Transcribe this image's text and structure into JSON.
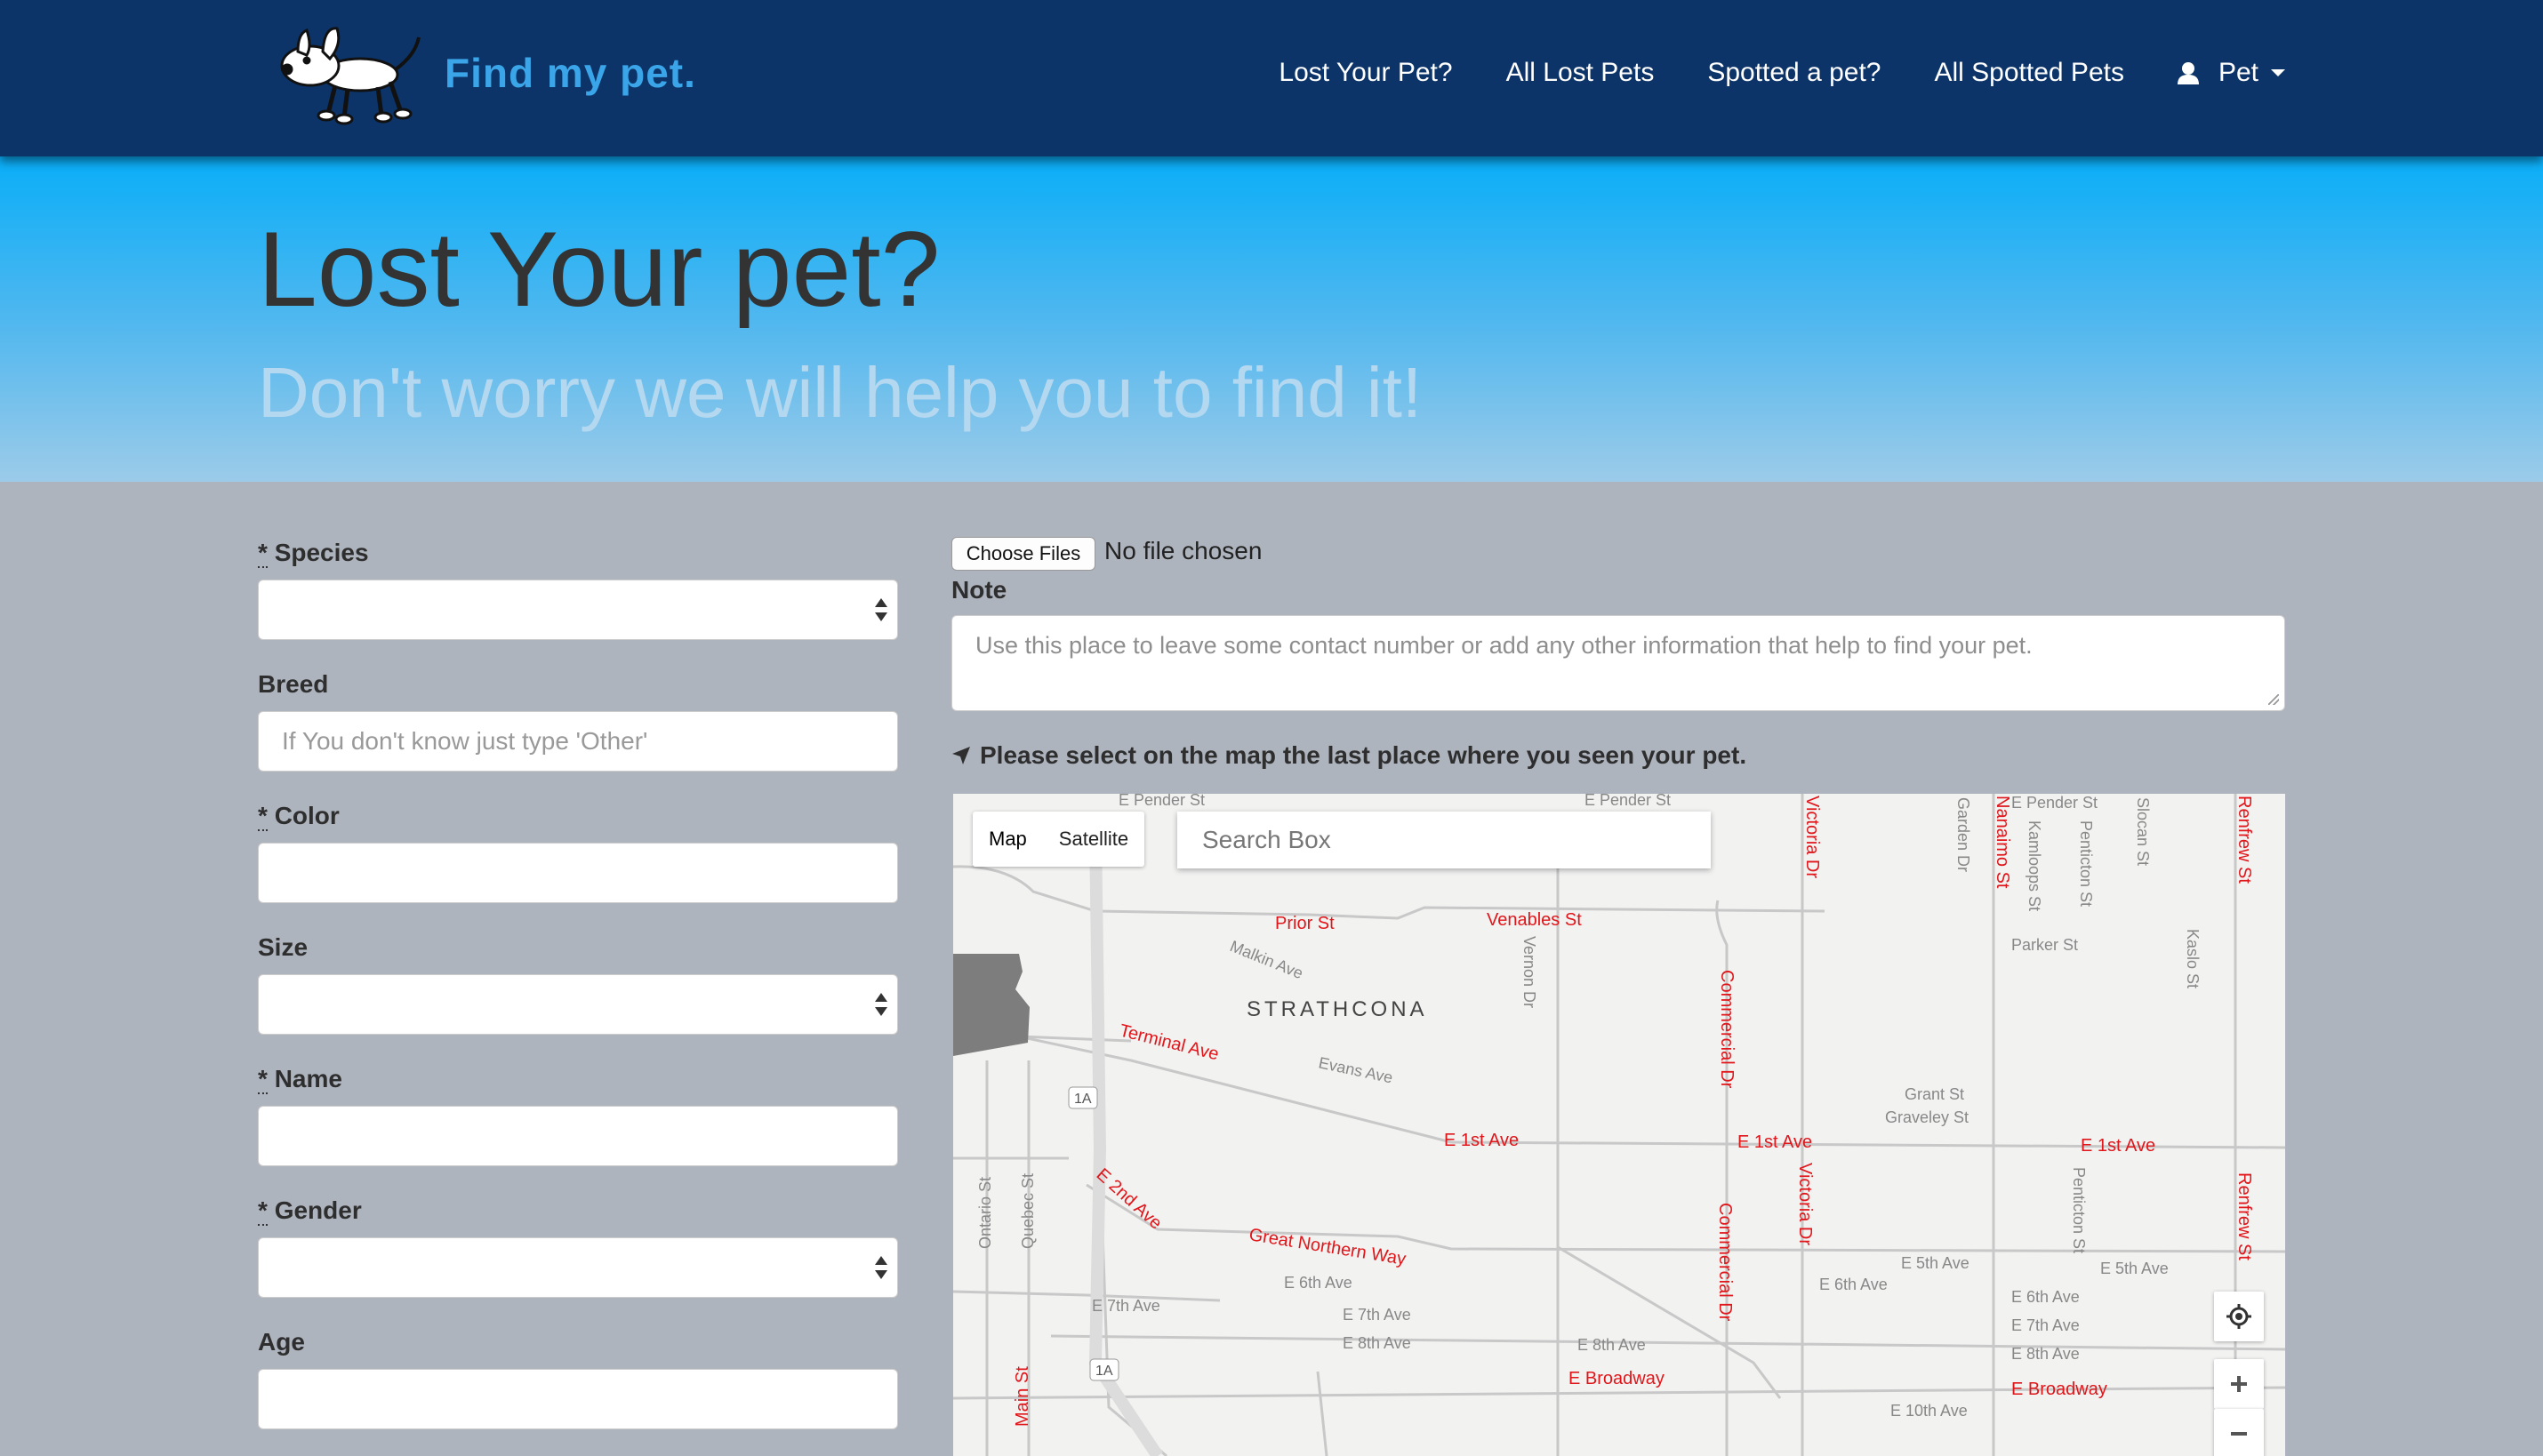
{
  "nav": {
    "brand": "Find my pet.",
    "links": [
      "Lost Your Pet?",
      "All Lost Pets",
      "Spotted a pet?",
      "All Spotted Pets"
    ],
    "user_label": "Pet"
  },
  "hero": {
    "title": "Lost Your pet?",
    "subtitle": "Don't worry we will help you to find it!"
  },
  "form": {
    "species_label": "Species",
    "breed_label": "Breed",
    "breed_placeholder": "If You don't know just type 'Other'",
    "color_label": "Color",
    "size_label": "Size",
    "name_label": "Name",
    "gender_label": "Gender",
    "age_label": "Age",
    "required_mark": "*",
    "choose_files": "Choose Files",
    "no_file": "No file chosen",
    "note_label": "Note",
    "note_placeholder": "Use this place to leave some contact number or add any other information that help to find your pet.",
    "map_instruction": "Please select on the map the last place where you seen your pet."
  },
  "map": {
    "type_map": "Map",
    "type_satellite": "Satellite",
    "search_placeholder": "Search Box",
    "neighborhood": "STRATHCONA",
    "red_labels": [
      "Prior St",
      "Venables St",
      "Terminal Ave",
      "E 1st Ave",
      "E 1st Ave",
      "E 1st Ave",
      "E 2nd Ave",
      "Great Northern Way",
      "E Broadway",
      "E Broadway",
      "Victoria Dr",
      "Victoria Dr",
      "Commercial Dr",
      "Commercial Dr",
      "Nanaimo St",
      "Renfrew St",
      "Renfrew St",
      "Main St",
      "St"
    ],
    "grey_labels": [
      "E Pender St",
      "E Pender St",
      "E Pender St",
      "Malkin Ave",
      "Evans Ave",
      "Vernon Dr",
      "Grant St",
      "Graveley St",
      "Parker St",
      "Garden Dr",
      "Kamloops St",
      "Penticton St",
      "Slocan St",
      "Kaslo St",
      "E 5th Ave",
      "E 5th Ave",
      "E 6th Ave",
      "E 6th Ave",
      "E 6th Ave",
      "E 7th Ave",
      "E 7th Ave",
      "E 7th Ave",
      "E 8th Ave",
      "E 8th Ave",
      "E 8th Ave",
      "E 10th Ave",
      "Ontario St",
      "Quebec St",
      "Penticton St",
      "1A",
      "1A"
    ]
  },
  "colors": {
    "navbar": "#0c3468",
    "brand": "#3aa5e8",
    "body_bg": "#aeb4be",
    "road_label": "#e0161b"
  }
}
